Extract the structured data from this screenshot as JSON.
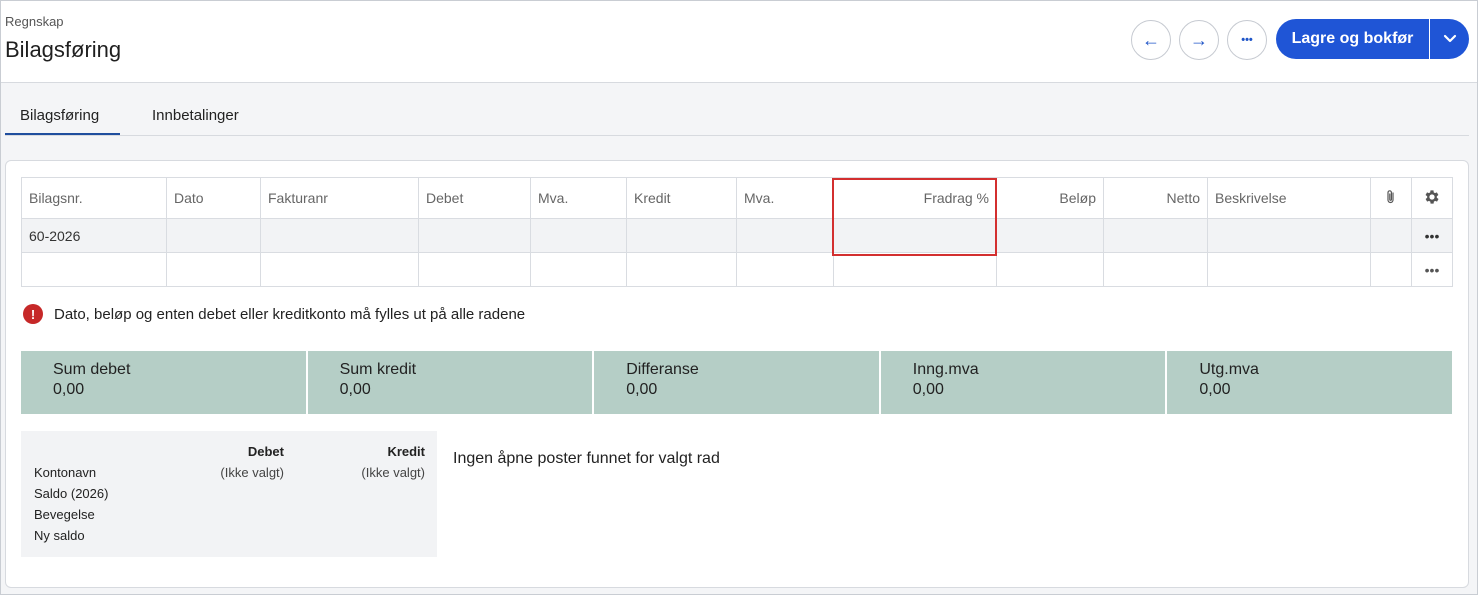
{
  "header": {
    "breadcrumb": "Regnskap",
    "title": "Bilagsføring",
    "back_icon": "←",
    "forward_icon": "→",
    "more_icon": "•••",
    "primary_label": "Lagre og bokfør",
    "accent_color": "#1f55d6"
  },
  "tabs": [
    {
      "label": "Bilagsføring",
      "active": true
    },
    {
      "label": "Innbetalinger",
      "active": false
    }
  ],
  "grid": {
    "columns": [
      "Bilagsnr.",
      "Dato",
      "Fakturanr",
      "Debet",
      "Mva.",
      "Kredit",
      "Mva.",
      "Fradrag %",
      "Beløp",
      "Netto",
      "Beskrivelse"
    ],
    "rows": [
      {
        "bilagsnr": "60-2026"
      },
      {
        "bilagsnr": ""
      }
    ],
    "row_menu_icon": "•••"
  },
  "error": {
    "message": "Dato, beløp og enten debet eller kreditkonto må fylles ut på alle radene",
    "color": "#c62828"
  },
  "sums": [
    {
      "label": "Sum debet",
      "value": "0,00"
    },
    {
      "label": "Sum kredit",
      "value": "0,00"
    },
    {
      "label": "Differanse",
      "value": "0,00"
    },
    {
      "label": "Inng.mva",
      "value": "0,00"
    },
    {
      "label": "Utg.mva",
      "value": "0,00"
    }
  ],
  "account": {
    "debet_header": "Debet",
    "kredit_header": "Kredit",
    "debet_value": "(Ikke valgt)",
    "kredit_value": "(Ikke valgt)",
    "labels": [
      "Kontonavn",
      "Saldo (2026)",
      "Bevegelse",
      "Ny saldo"
    ]
  },
  "open_items_message": "Ingen åpne poster funnet for valgt rad"
}
